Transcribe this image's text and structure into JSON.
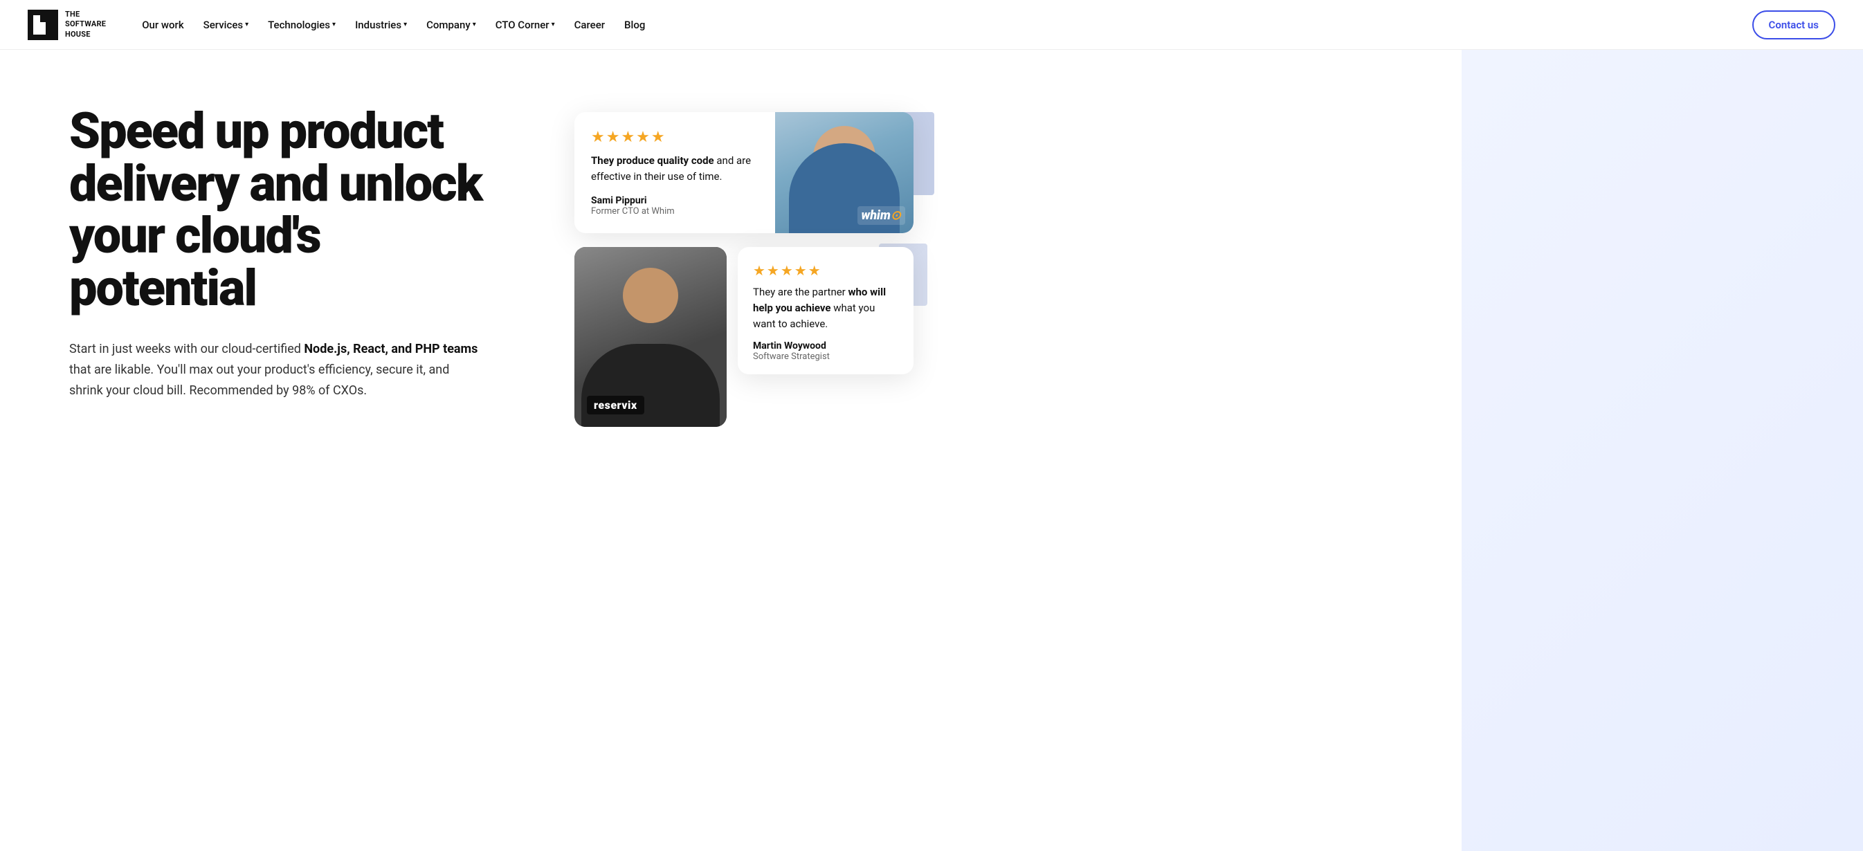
{
  "nav": {
    "logo_line1": "THE",
    "logo_line2": "SOFTWARE",
    "logo_line3": "HOUSE",
    "items": [
      {
        "label": "Our work",
        "has_dropdown": false
      },
      {
        "label": "Services",
        "has_dropdown": true
      },
      {
        "label": "Technologies",
        "has_dropdown": true
      },
      {
        "label": "Industries",
        "has_dropdown": true
      },
      {
        "label": "Company",
        "has_dropdown": true
      },
      {
        "label": "CTO Corner",
        "has_dropdown": true
      },
      {
        "label": "Career",
        "has_dropdown": false
      },
      {
        "label": "Blog",
        "has_dropdown": false
      }
    ],
    "contact_label": "Contact us"
  },
  "hero": {
    "title": "Speed up product delivery and unlock your cloud's potential",
    "description_plain": "Start in just weeks with our cloud-certified ",
    "description_bold": "Node.js, React, and PHP teams",
    "description_end": " that are likable. You'll max out your product's efficiency, secure it, and shrink your cloud bill. Recommended by 98% of CXOs."
  },
  "testimonials": {
    "top": {
      "stars": "★★★★★",
      "quote_bold": "They produce quality code",
      "quote_rest": " and are effective in their use of time.",
      "author": "Sami Pippuri",
      "role": "Former CTO at Whim",
      "company_badge": "whim",
      "company_dot": "⊙"
    },
    "bottom": {
      "stars": "★★★★★",
      "quote_plain": "They are the partner ",
      "quote_bold": "who will help you achieve",
      "quote_rest": " what you want to achieve.",
      "author": "Martin Woywood",
      "role": "Software Strategist",
      "company_badge": "reservix"
    }
  }
}
